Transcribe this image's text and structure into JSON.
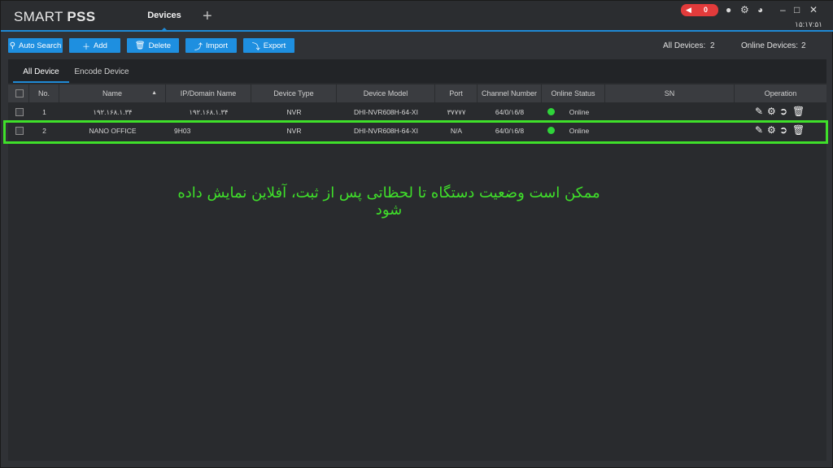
{
  "app": {
    "logo_light": "SMART",
    "logo_bold": "PSS",
    "tab_title": "Devices",
    "add_tab": "+",
    "alarm_count": "0",
    "clock": "۱۵:۱۷:۵۱"
  },
  "toolbar": {
    "auto_search": "Auto Search",
    "add": "Add",
    "delete": "Delete",
    "import": "Import",
    "export": "Export",
    "all_devices_label": "All Devices:",
    "all_devices_count": "2",
    "online_devices_label": "Online Devices:",
    "online_devices_count": "2"
  },
  "subtabs": {
    "all_device": "All Device",
    "encode_device": "Encode Device"
  },
  "table": {
    "headers": {
      "no": "No.",
      "name": "Name",
      "ip": "IP/Domain Name",
      "type": "Device Type",
      "model": "Device Model",
      "port": "Port",
      "channel": "Channel Number",
      "status": "Online Status",
      "sn": "SN",
      "operation": "Operation"
    },
    "rows": [
      {
        "no": "1",
        "name": "۱۹۲.۱۶۸.۱.۳۴",
        "ip": "۱۹۲.۱۶۸.۱.۳۴",
        "type": "NVR",
        "model": "DHI-NVR608H-64-XI",
        "port": "۳۷۷۷۷",
        "channel": "64/0/۱6/8",
        "status": "Online",
        "sn": ""
      },
      {
        "no": "2",
        "name": "NANO OFFICE",
        "ip": "9H03",
        "type": "NVR",
        "model": "DHI-NVR608H-64-XI",
        "port": "N/A",
        "channel": "64/0/۱6/8",
        "status": "Online",
        "sn": ""
      }
    ]
  },
  "annotation": "ممکن است وضعیت دستگاه تا لحظاتی پس از ثبت، آفلاین نمایش داده شود",
  "colors": {
    "accent": "#1e8fe0",
    "online": "#2fd43a",
    "highlight": "#3fe02a",
    "alarm": "#e23b3b"
  },
  "icons": [
    "speaker-icon",
    "user-icon",
    "gear-icon",
    "gauge-icon",
    "minimize-icon",
    "maximize-icon",
    "close-icon",
    "search-icon",
    "plus-icon",
    "trash-icon",
    "import-icon",
    "export-icon",
    "edit-icon",
    "settings-icon",
    "logout-icon",
    "sort-up-icon"
  ]
}
